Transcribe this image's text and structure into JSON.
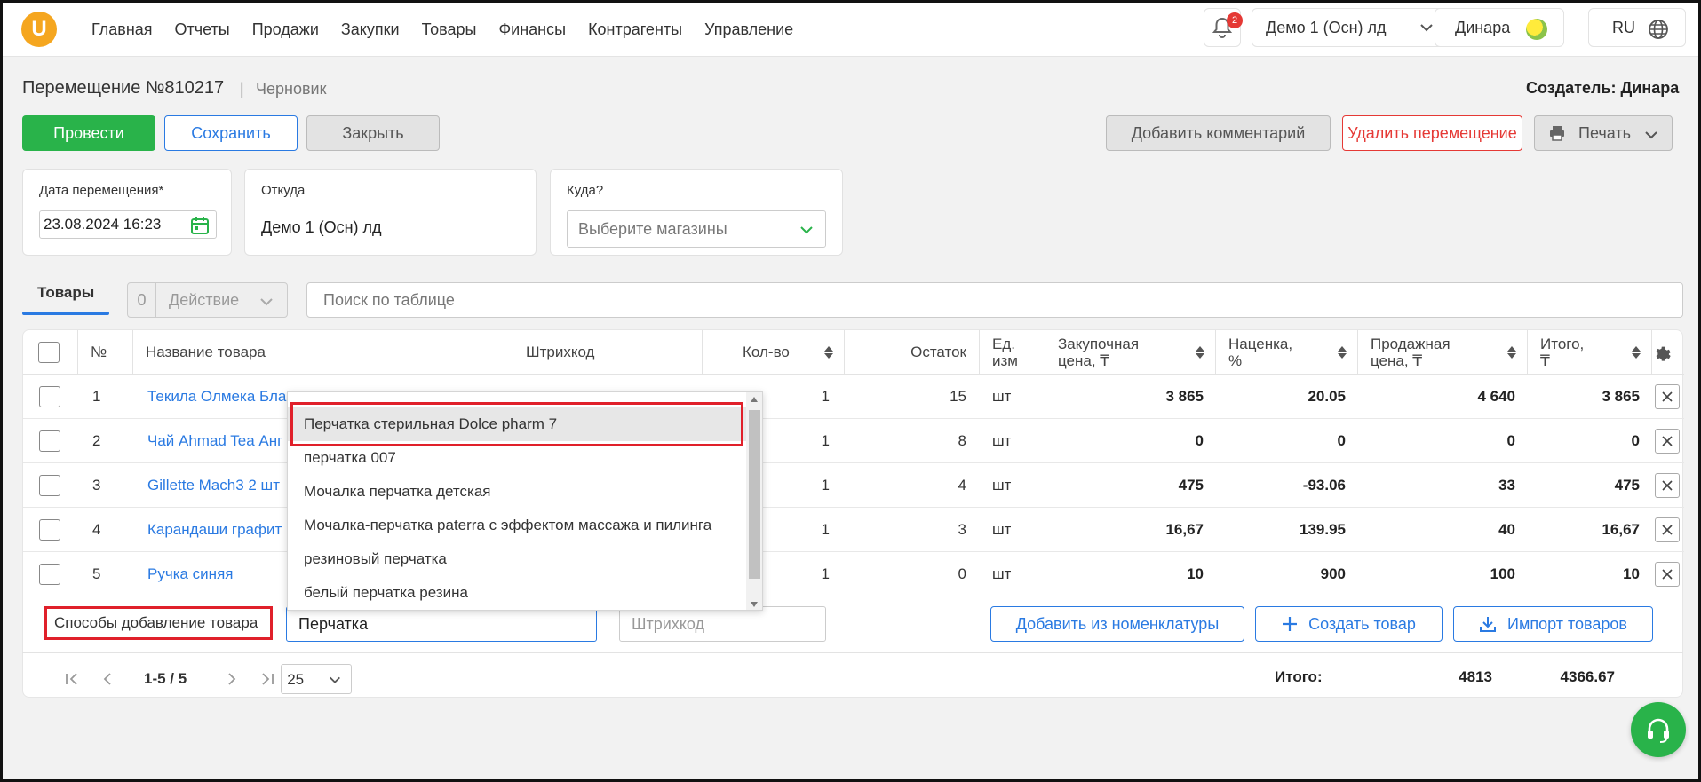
{
  "nav": {
    "logo": "U",
    "menu": [
      "Главная",
      "Отчеты",
      "Продажи",
      "Закупки",
      "Товары",
      "Финансы",
      "Контрагенты",
      "Управление"
    ],
    "notifications_count": "2",
    "store": "Демо 1 (Осн) лд",
    "user": "Динара",
    "lang": "RU"
  },
  "header": {
    "title": "Перемещение №810217",
    "separator": "|",
    "status": "Черновик",
    "creator": "Создатель: Динара"
  },
  "toolbar": {
    "post": "Провести",
    "save": "Сохранить",
    "close": "Закрыть",
    "add_comment": "Добавить комментарий",
    "delete": "Удалить перемещение",
    "print": "Печать"
  },
  "form": {
    "date_label": "Дата перемещения*",
    "date_value": "23.08.2024 16:23",
    "from_label": "Откуда",
    "from_value": "Демо 1 (Осн) лд",
    "to_label": "Куда?",
    "to_placeholder": "Выберите магазины"
  },
  "tabs": {
    "goods": "Товары",
    "action_count": "0",
    "action_label": "Действие",
    "search_placeholder": "Поиск по таблице"
  },
  "table": {
    "headers": {
      "num": "№",
      "name": "Название товара",
      "barcode": "Штрихкод",
      "qty": "Кол-во",
      "stock": "Остаток",
      "unit_1": "Ед.",
      "unit_2": "изм",
      "purchase_1": "Закупочная",
      "purchase_2": "цена, ₸",
      "markup_1": "Наценка,",
      "markup_2": "%",
      "sale_1": "Продажная",
      "sale_2": "цена, ₸",
      "total_1": "Итого,",
      "total_2": "₸"
    },
    "rows": [
      {
        "num": "1",
        "name": "Текила Олмека Бла",
        "qty": "1",
        "stock": "15",
        "unit": "шт",
        "purchase": "3 865",
        "markup": "20.05",
        "sale": "4 640",
        "total": "3 865"
      },
      {
        "num": "2",
        "name": "Чай Ahmad Tea Анг",
        "qty": "1",
        "stock": "8",
        "unit": "шт",
        "purchase": "0",
        "markup": "0",
        "sale": "0",
        "total": "0"
      },
      {
        "num": "3",
        "name": "Gillette Mach3 2 шт",
        "qty": "1",
        "stock": "4",
        "unit": "шт",
        "purchase": "475",
        "markup": "-93.06",
        "sale": "33",
        "total": "475"
      },
      {
        "num": "4",
        "name": "Карандаши графит",
        "qty": "1",
        "stock": "3",
        "unit": "шт",
        "purchase": "16,67",
        "markup": "139.95",
        "sale": "40",
        "total": "16,67"
      },
      {
        "num": "5",
        "name": "Ручка синяя",
        "qty": "1",
        "stock": "0",
        "unit": "шт",
        "purchase": "10",
        "markup": "900",
        "sale": "100",
        "total": "10"
      }
    ]
  },
  "add_row": {
    "ways_label": "Способы добавление товара",
    "product_input_value": "Перчатка",
    "barcode_placeholder": "Штрихкод",
    "from_catalog": "Добавить из номенклатуры",
    "create_product": "Создать товар",
    "import_products": "Импорт товаров"
  },
  "dropdown": {
    "items": [
      "Перчатка стерильная Dolce pharm 7",
      "перчатка 007",
      "Мочалка перчатка детская",
      "Мочалка-перчатка paterra с эффектом массажа и пилинга",
      "резиновый перчатка",
      "белый перчатка резина"
    ]
  },
  "footer": {
    "range": "1-5 / 5",
    "page_size": "25",
    "total_label": "Итого:",
    "total_qty": "4813",
    "total_sum": "4366.67"
  },
  "colors": {
    "accent": "#2a7ae2",
    "success": "#29b34a",
    "danger": "#e53935",
    "highlight": "#e0202a"
  }
}
